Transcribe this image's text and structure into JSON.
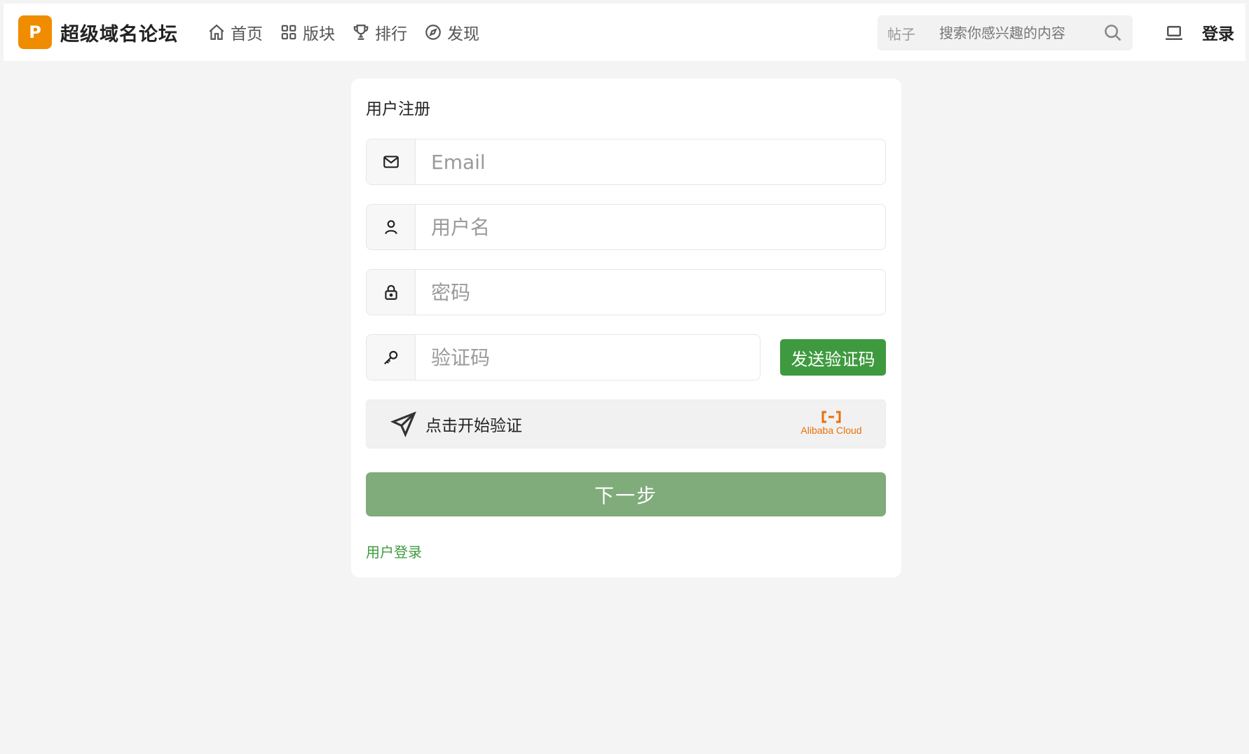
{
  "header": {
    "logo_letter": "P",
    "site_name": "超级域名论坛",
    "nav": [
      {
        "label": "首页",
        "icon": "home-icon"
      },
      {
        "label": "版块",
        "icon": "grid-icon"
      },
      {
        "label": "排行",
        "icon": "trophy-icon"
      },
      {
        "label": "发现",
        "icon": "compass-icon"
      }
    ],
    "search": {
      "type_label": "帖子",
      "placeholder": "搜索你感兴趣的内容"
    },
    "login_label": "登录"
  },
  "register": {
    "title": "用户注册",
    "email_placeholder": "Email",
    "username_placeholder": "用户名",
    "password_placeholder": "密码",
    "code_placeholder": "验证码",
    "send_code_label": "发送验证码",
    "captcha_label": "点击开始验证",
    "captcha_brand": "Alibaba Cloud",
    "next_label": "下一步",
    "login_link": "用户登录"
  },
  "colors": {
    "brand": "#f08c00",
    "green": "#3f9a3f",
    "next_button": "#80ab7b",
    "alibaba": "#e8710a"
  }
}
